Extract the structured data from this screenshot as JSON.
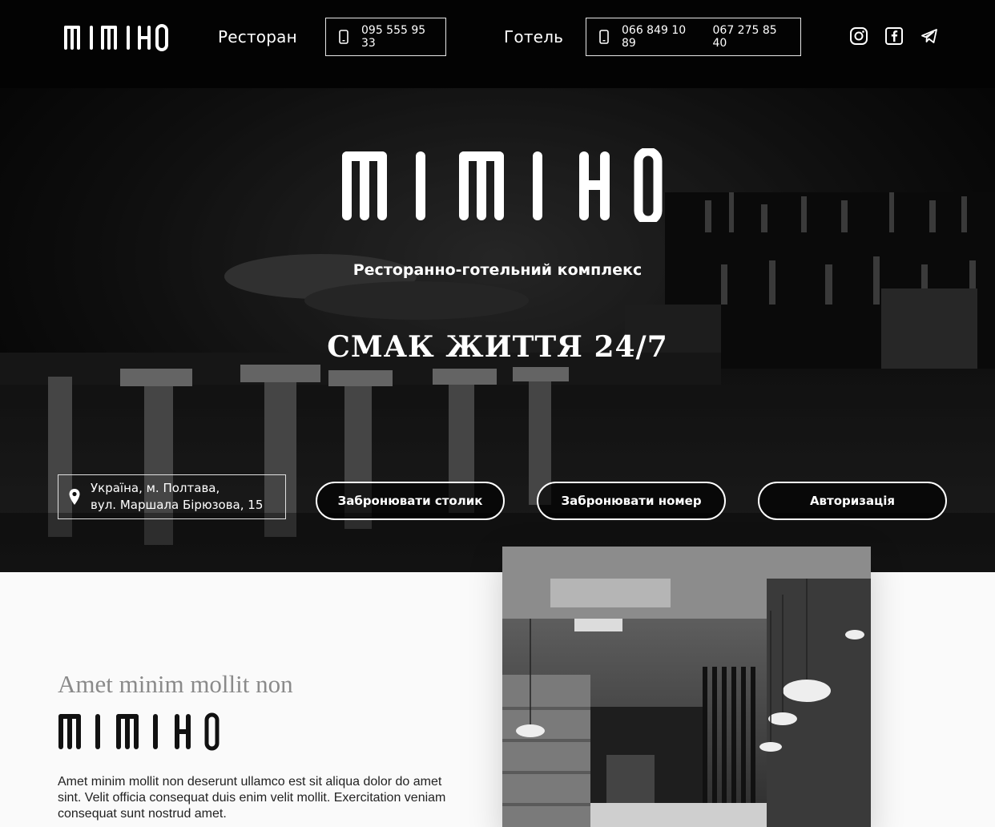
{
  "brand": {
    "name": "MIMIHO",
    "tagline": "Ресторанно-готельний комплекс",
    "slogan": "СМАК ЖИТТЯ 24/7"
  },
  "header": {
    "restaurant_label": "Ресторан",
    "restaurant_phone": "095 555 95 33",
    "hotel_label": "Готель",
    "hotel_phones": [
      "066 849 10 89",
      "067 275 85 40"
    ],
    "social": [
      "instagram-icon",
      "facebook-icon",
      "telegram-icon"
    ]
  },
  "address": {
    "line1": "Україна, м. Полтава,",
    "line2": "вул. Маршала Бірюзова, 15"
  },
  "actions": {
    "book_table": "Забронювати столик",
    "book_room": "Забронювати номер",
    "login": "Авторизація"
  },
  "about": {
    "eyebrow": "Amet minim mollit non",
    "text": "Amet minim mollit non deserunt ullamco est sit aliqua dolor do amet sint. Velit officia consequat duis enim velit mollit. Exercitation veniam consequat sunt nostrud amet."
  },
  "colors": {
    "hero_bg": "#0a0a0a",
    "page_bg": "#fafafa",
    "text_light": "#ffffff",
    "text_dark": "#222222",
    "eyebrow": "#8a8a8a"
  }
}
